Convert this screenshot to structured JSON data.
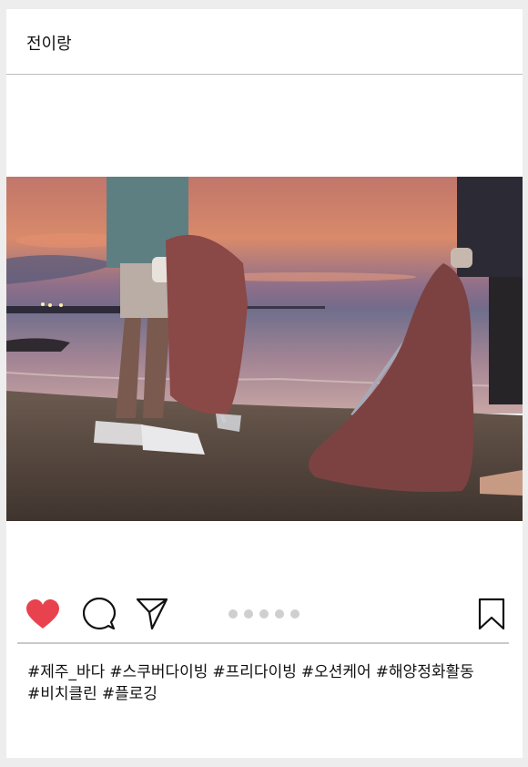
{
  "post": {
    "username": "전이랑",
    "photo_alt": "beach clean-up at sunset",
    "carousel": {
      "count": 5,
      "active": 0
    },
    "hashtags": [
      "#제주_바다",
      "#스쿠버다이빙",
      "#프리다이빙",
      "#오션케어",
      "#해양정화활동",
      "#비치클린",
      "#플로깅"
    ]
  },
  "icons": {
    "like": "heart-icon",
    "comment": "comment-icon",
    "share": "send-icon",
    "save": "bookmark-icon"
  },
  "colors": {
    "heart": "#e8424e",
    "dot": "#cfcfcf",
    "divider": "#c9c9c9"
  }
}
